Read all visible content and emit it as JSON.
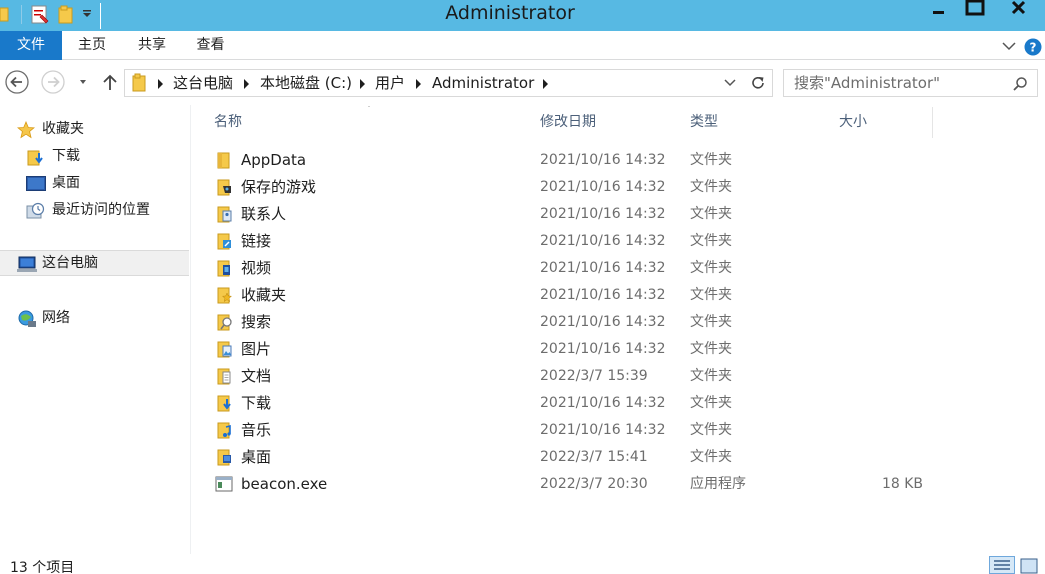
{
  "window": {
    "title": "Administrator",
    "colors": {
      "titlebar": "#57b9e3",
      "accent": "#1979ca"
    }
  },
  "ribbon": {
    "tabs": [
      {
        "label": "文件"
      },
      {
        "label": "主页"
      },
      {
        "label": "共享"
      },
      {
        "label": "查看"
      }
    ]
  },
  "address": {
    "breadcrumbs": [
      "这台电脑",
      "本地磁盘 (C:)",
      "用户",
      "Administrator"
    ]
  },
  "search": {
    "placeholder": "搜索\"Administrator\""
  },
  "navpane": {
    "items": [
      {
        "label": "收藏夹",
        "icon": "star-icon"
      },
      {
        "label": "下载",
        "icon": "downloads-folder-icon"
      },
      {
        "label": "桌面",
        "icon": "desktop-icon"
      },
      {
        "label": "最近访问的位置",
        "icon": "recent-places-icon"
      },
      {
        "label": "这台电脑",
        "icon": "computer-icon",
        "selected": true
      },
      {
        "label": "网络",
        "icon": "network-icon"
      }
    ]
  },
  "columns": [
    {
      "label": "名称"
    },
    {
      "label": "修改日期"
    },
    {
      "label": "类型"
    },
    {
      "label": "大小"
    }
  ],
  "files": [
    {
      "name": "AppData",
      "date": "2021/10/16 14:32",
      "type": "文件夹",
      "size": "",
      "icon": "folder-icon"
    },
    {
      "name": "保存的游戏",
      "date": "2021/10/16 14:32",
      "type": "文件夹",
      "size": "",
      "icon": "saved-games-folder-icon"
    },
    {
      "name": "联系人",
      "date": "2021/10/16 14:32",
      "type": "文件夹",
      "size": "",
      "icon": "contacts-folder-icon"
    },
    {
      "name": "链接",
      "date": "2021/10/16 14:32",
      "type": "文件夹",
      "size": "",
      "icon": "links-folder-icon"
    },
    {
      "name": "视频",
      "date": "2021/10/16 14:32",
      "type": "文件夹",
      "size": "",
      "icon": "videos-folder-icon"
    },
    {
      "name": "收藏夹",
      "date": "2021/10/16 14:32",
      "type": "文件夹",
      "size": "",
      "icon": "favorites-folder-icon"
    },
    {
      "name": "搜索",
      "date": "2021/10/16 14:32",
      "type": "文件夹",
      "size": "",
      "icon": "searches-folder-icon"
    },
    {
      "name": "图片",
      "date": "2021/10/16 14:32",
      "type": "文件夹",
      "size": "",
      "icon": "pictures-folder-icon"
    },
    {
      "name": "文档",
      "date": "2022/3/7 15:39",
      "type": "文件夹",
      "size": "",
      "icon": "documents-folder-icon"
    },
    {
      "name": "下载",
      "date": "2021/10/16 14:32",
      "type": "文件夹",
      "size": "",
      "icon": "downloads-folder-icon"
    },
    {
      "name": "音乐",
      "date": "2021/10/16 14:32",
      "type": "文件夹",
      "size": "",
      "icon": "music-folder-icon"
    },
    {
      "name": "桌面",
      "date": "2022/3/7 15:41",
      "type": "文件夹",
      "size": "",
      "icon": "desktop-folder-icon"
    },
    {
      "name": "beacon.exe",
      "date": "2022/3/7 20:30",
      "type": "应用程序",
      "size": "18 KB",
      "icon": "exe-file-icon"
    }
  ],
  "status": {
    "item_count": "13 个项目"
  }
}
